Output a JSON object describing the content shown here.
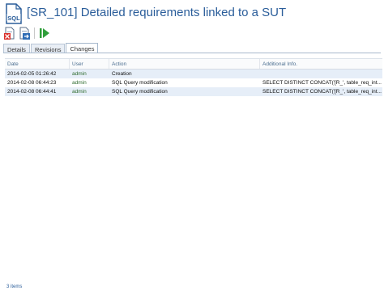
{
  "header": {
    "title": "[SR_101] Detailed requirements linked to a SUT",
    "icon_text": "SQL"
  },
  "toolbar": {
    "buttons": [
      {
        "name": "delete-icon"
      },
      {
        "name": "export-icon"
      },
      {
        "name": "run-icon"
      }
    ]
  },
  "tabs": [
    {
      "label": "Details",
      "active": false
    },
    {
      "label": "Revisions",
      "active": false
    },
    {
      "label": "Changes",
      "active": true
    }
  ],
  "grid": {
    "columns": [
      "Date",
      "User",
      "Action",
      "Additional Info."
    ],
    "rows": [
      {
        "date": "2014-02-05 01:26:42",
        "user": "admin",
        "action": "Creation",
        "info": ""
      },
      {
        "date": "2014-02-08 06:44:23",
        "user": "admin",
        "action": "SQL Query modification",
        "info": "SELECT DISTINCT CONCAT('[R_', table_req_int..."
      },
      {
        "date": "2014-02-08 06:44:41",
        "user": "admin",
        "action": "SQL Query modification",
        "info": "SELECT DISTINCT CONCAT('[R_', table_req_int..."
      }
    ]
  },
  "footer": {
    "count": "3 items"
  },
  "colors": {
    "title": "#2a5d9a",
    "row_alt": "#e6eef8",
    "user_text": "#2e6b2e"
  }
}
